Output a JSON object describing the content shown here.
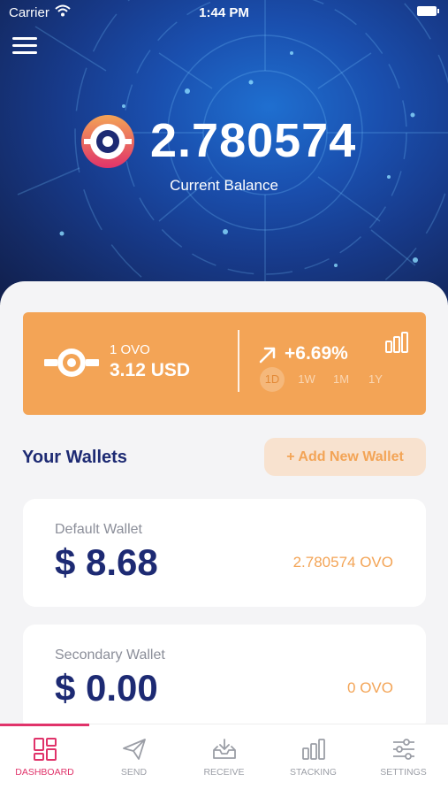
{
  "status_bar": {
    "carrier": "Carrier",
    "time": "1:44 PM"
  },
  "header": {
    "balance": "2.780574",
    "balance_label": "Current Balance"
  },
  "price_card": {
    "coin_amount": "1 OVO",
    "usd_value": "3.12 USD",
    "change": "+6.69%",
    "ranges": [
      "1D",
      "1W",
      "1M",
      "1Y"
    ],
    "selected_range": "1D"
  },
  "wallets_section": {
    "title": "Your Wallets",
    "add_button": "+ Add New Wallet"
  },
  "wallets": [
    {
      "name": "Default Wallet",
      "usd": "$ 8.68",
      "ovo": "2.780574 OVO"
    },
    {
      "name": "Secondary Wallet",
      "usd": "$ 0.00",
      "ovo": "0 OVO"
    }
  ],
  "tabs": [
    {
      "label": "DASHBOARD",
      "icon": "dashboard-icon",
      "active": true
    },
    {
      "label": "SEND",
      "icon": "send-icon",
      "active": false
    },
    {
      "label": "RECEIVE",
      "icon": "receive-icon",
      "active": false
    },
    {
      "label": "STACKING",
      "icon": "stacking-icon",
      "active": false
    },
    {
      "label": "SETTINGS",
      "icon": "settings-icon",
      "active": false
    }
  ],
  "colors": {
    "accent_orange": "#f3a456",
    "navy": "#1d2a73",
    "active_tab": "#e0336a"
  }
}
